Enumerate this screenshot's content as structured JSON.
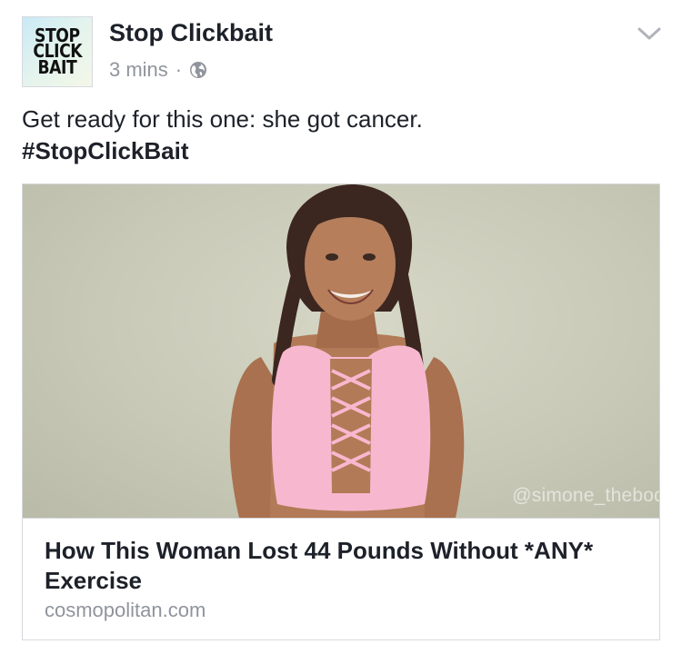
{
  "post": {
    "avatar_lines": [
      "STOP",
      "CLICK",
      "BAIT"
    ],
    "page_name": "Stop Clickbait",
    "timestamp": "3 mins",
    "separator": "·",
    "privacy_icon": "globe-icon",
    "menu_icon": "chevron-down-icon",
    "message": "Get ready for this one: she got cancer.",
    "hashtag": "#StopClickBait"
  },
  "link_card": {
    "image_watermark": "@simone_thebod",
    "headline": "How This Woman Lost 44 Pounds Without *ANY* Exercise",
    "domain": "cosmopolitan.com"
  },
  "colors": {
    "text": "#1d2129",
    "secondary_text": "#90949c",
    "border": "#d6d9de",
    "photo_background": "#c8c9b7",
    "top_color": "#f7b8cf"
  }
}
